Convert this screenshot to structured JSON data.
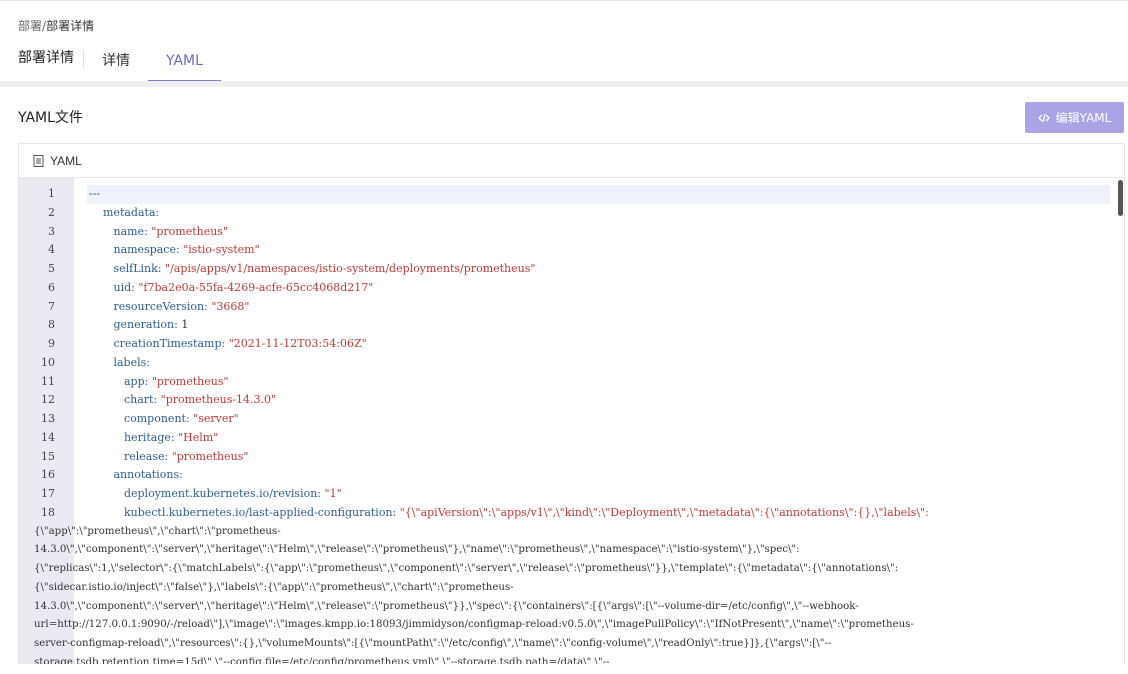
{
  "breadcrumb": {
    "parent": "部署",
    "separator": "/",
    "current": "部署详情"
  },
  "page_title": "部署详情",
  "tabs": [
    {
      "label": "详情",
      "active": false
    },
    {
      "label": "YAML",
      "active": true
    }
  ],
  "section_title": "YAML文件",
  "edit_button": {
    "label": "编辑YAML",
    "icon": "code-icon"
  },
  "card_title": "YAML",
  "card_icon": "document-icon",
  "colors": {
    "accent": "#7f78d6",
    "button_bg": "#aaa4e6",
    "key": "#2e5e8c",
    "string": "#c03a3a",
    "gutter": "#eaeaf3"
  },
  "line_numbers": [
    "1",
    "2",
    "3",
    "4",
    "5",
    "6",
    "7",
    "8",
    "9",
    "10",
    "11",
    "12",
    "13",
    "14",
    "15",
    "16",
    "17",
    "18"
  ],
  "yaml_lines": [
    {
      "indent": 0,
      "key": "---",
      "value": "",
      "vtype": "dash"
    },
    {
      "indent": 1,
      "key": "metadata:",
      "value": "",
      "vtype": "none"
    },
    {
      "indent": 2,
      "key": "name:",
      "value": "\"prometheus\"",
      "vtype": "str"
    },
    {
      "indent": 2,
      "key": "namespace:",
      "value": "\"istio-system\"",
      "vtype": "str"
    },
    {
      "indent": 2,
      "key": "selfLink:",
      "value": "\"/apis/apps/v1/namespaces/istio-system/deployments/prometheus\"",
      "vtype": "str"
    },
    {
      "indent": 2,
      "key": "uid:",
      "value": "\"f7ba2e0a-55fa-4269-acfe-65cc4068d217\"",
      "vtype": "str"
    },
    {
      "indent": 2,
      "key": "resourceVersion:",
      "value": "\"3668\"",
      "vtype": "str"
    },
    {
      "indent": 2,
      "key": "generation:",
      "value": "1",
      "vtype": "num"
    },
    {
      "indent": 2,
      "key": "creationTimestamp:",
      "value": "\"2021-11-12T03:54:06Z\"",
      "vtype": "str"
    },
    {
      "indent": 2,
      "key": "labels:",
      "value": "",
      "vtype": "none"
    },
    {
      "indent": 3,
      "key": "app:",
      "value": "\"prometheus\"",
      "vtype": "str"
    },
    {
      "indent": 3,
      "key": "chart:",
      "value": "\"prometheus-14.3.0\"",
      "vtype": "str"
    },
    {
      "indent": 3,
      "key": "component:",
      "value": "\"server\"",
      "vtype": "str"
    },
    {
      "indent": 3,
      "key": "heritage:",
      "value": "\"Helm\"",
      "vtype": "str"
    },
    {
      "indent": 3,
      "key": "release:",
      "value": "\"prometheus\"",
      "vtype": "str"
    },
    {
      "indent": 2,
      "key": "annotations:",
      "value": "",
      "vtype": "none"
    },
    {
      "indent": 3,
      "key": "deployment.kubernetes.io/revision:",
      "value": "\"1\"",
      "vtype": "str"
    },
    {
      "indent": 3,
      "key": "kubectl.kubernetes.io/last-applied-configuration:",
      "value": "\"{\\\"apiVersion\\\":\\\"apps/v1\\\",\\\"kind\\\":\\\"Deployment\\\",\\\"metadata\\\":{\\\"annotations\\\":{},\\\"labels\\\":",
      "vtype": "str"
    }
  ],
  "wrapped_lines": [
    "{\\\"app\\\":\\\"prometheus\\\",\\\"chart\\\":\\\"prometheus-",
    "14.3.0\\\",\\\"component\\\":\\\"server\\\",\\\"heritage\\\":\\\"Helm\\\",\\\"release\\\":\\\"prometheus\\\"},\\\"name\\\":\\\"prometheus\\\",\\\"namespace\\\":\\\"istio-system\\\"},\\\"spec\\\":",
    "{\\\"replicas\\\":1,\\\"selector\\\":{\\\"matchLabels\\\":{\\\"app\\\":\\\"prometheus\\\",\\\"component\\\":\\\"server\\\",\\\"release\\\":\\\"prometheus\\\"}},\\\"template\\\":{\\\"metadata\\\":{\\\"annotations\\\":",
    "{\\\"sidecar.istio.io/inject\\\":\\\"false\\\"},\\\"labels\\\":{\\\"app\\\":\\\"prometheus\\\",\\\"chart\\\":\\\"prometheus-",
    "14.3.0\\\",\\\"component\\\":\\\"server\\\",\\\"heritage\\\":\\\"Helm\\\",\\\"release\\\":\\\"prometheus\\\"}},\\\"spec\\\":{\\\"containers\\\":[{\\\"args\\\":[\\\"--volume-dir=/etc/config\\\",\\\"--webhook-",
    "url=http://127.0.0.1:9090/-/reload\\\"],\\\"image\\\":\\\"images.kmpp.io:18093/jimmidyson/configmap-reload:v0.5.0\\\",\\\"imagePullPolicy\\\":\\\"IfNotPresent\\\",\\\"name\\\":\\\"prometheus-",
    "server-configmap-reload\\\",\\\"resources\\\":{},\\\"volumeMounts\\\":[{\\\"mountPath\\\":\\\"/etc/config\\\",\\\"name\\\":\\\"config-volume\\\",\\\"readOnly\\\":true}]},{\\\"args\\\":[\\\"--",
    "storage.tsdb.retention.time=15d\\\",\\\"--config.file=/etc/config/prometheus.yml\\\",\\\"--storage.tsdb.path=/data\\\",\\\"--"
  ]
}
